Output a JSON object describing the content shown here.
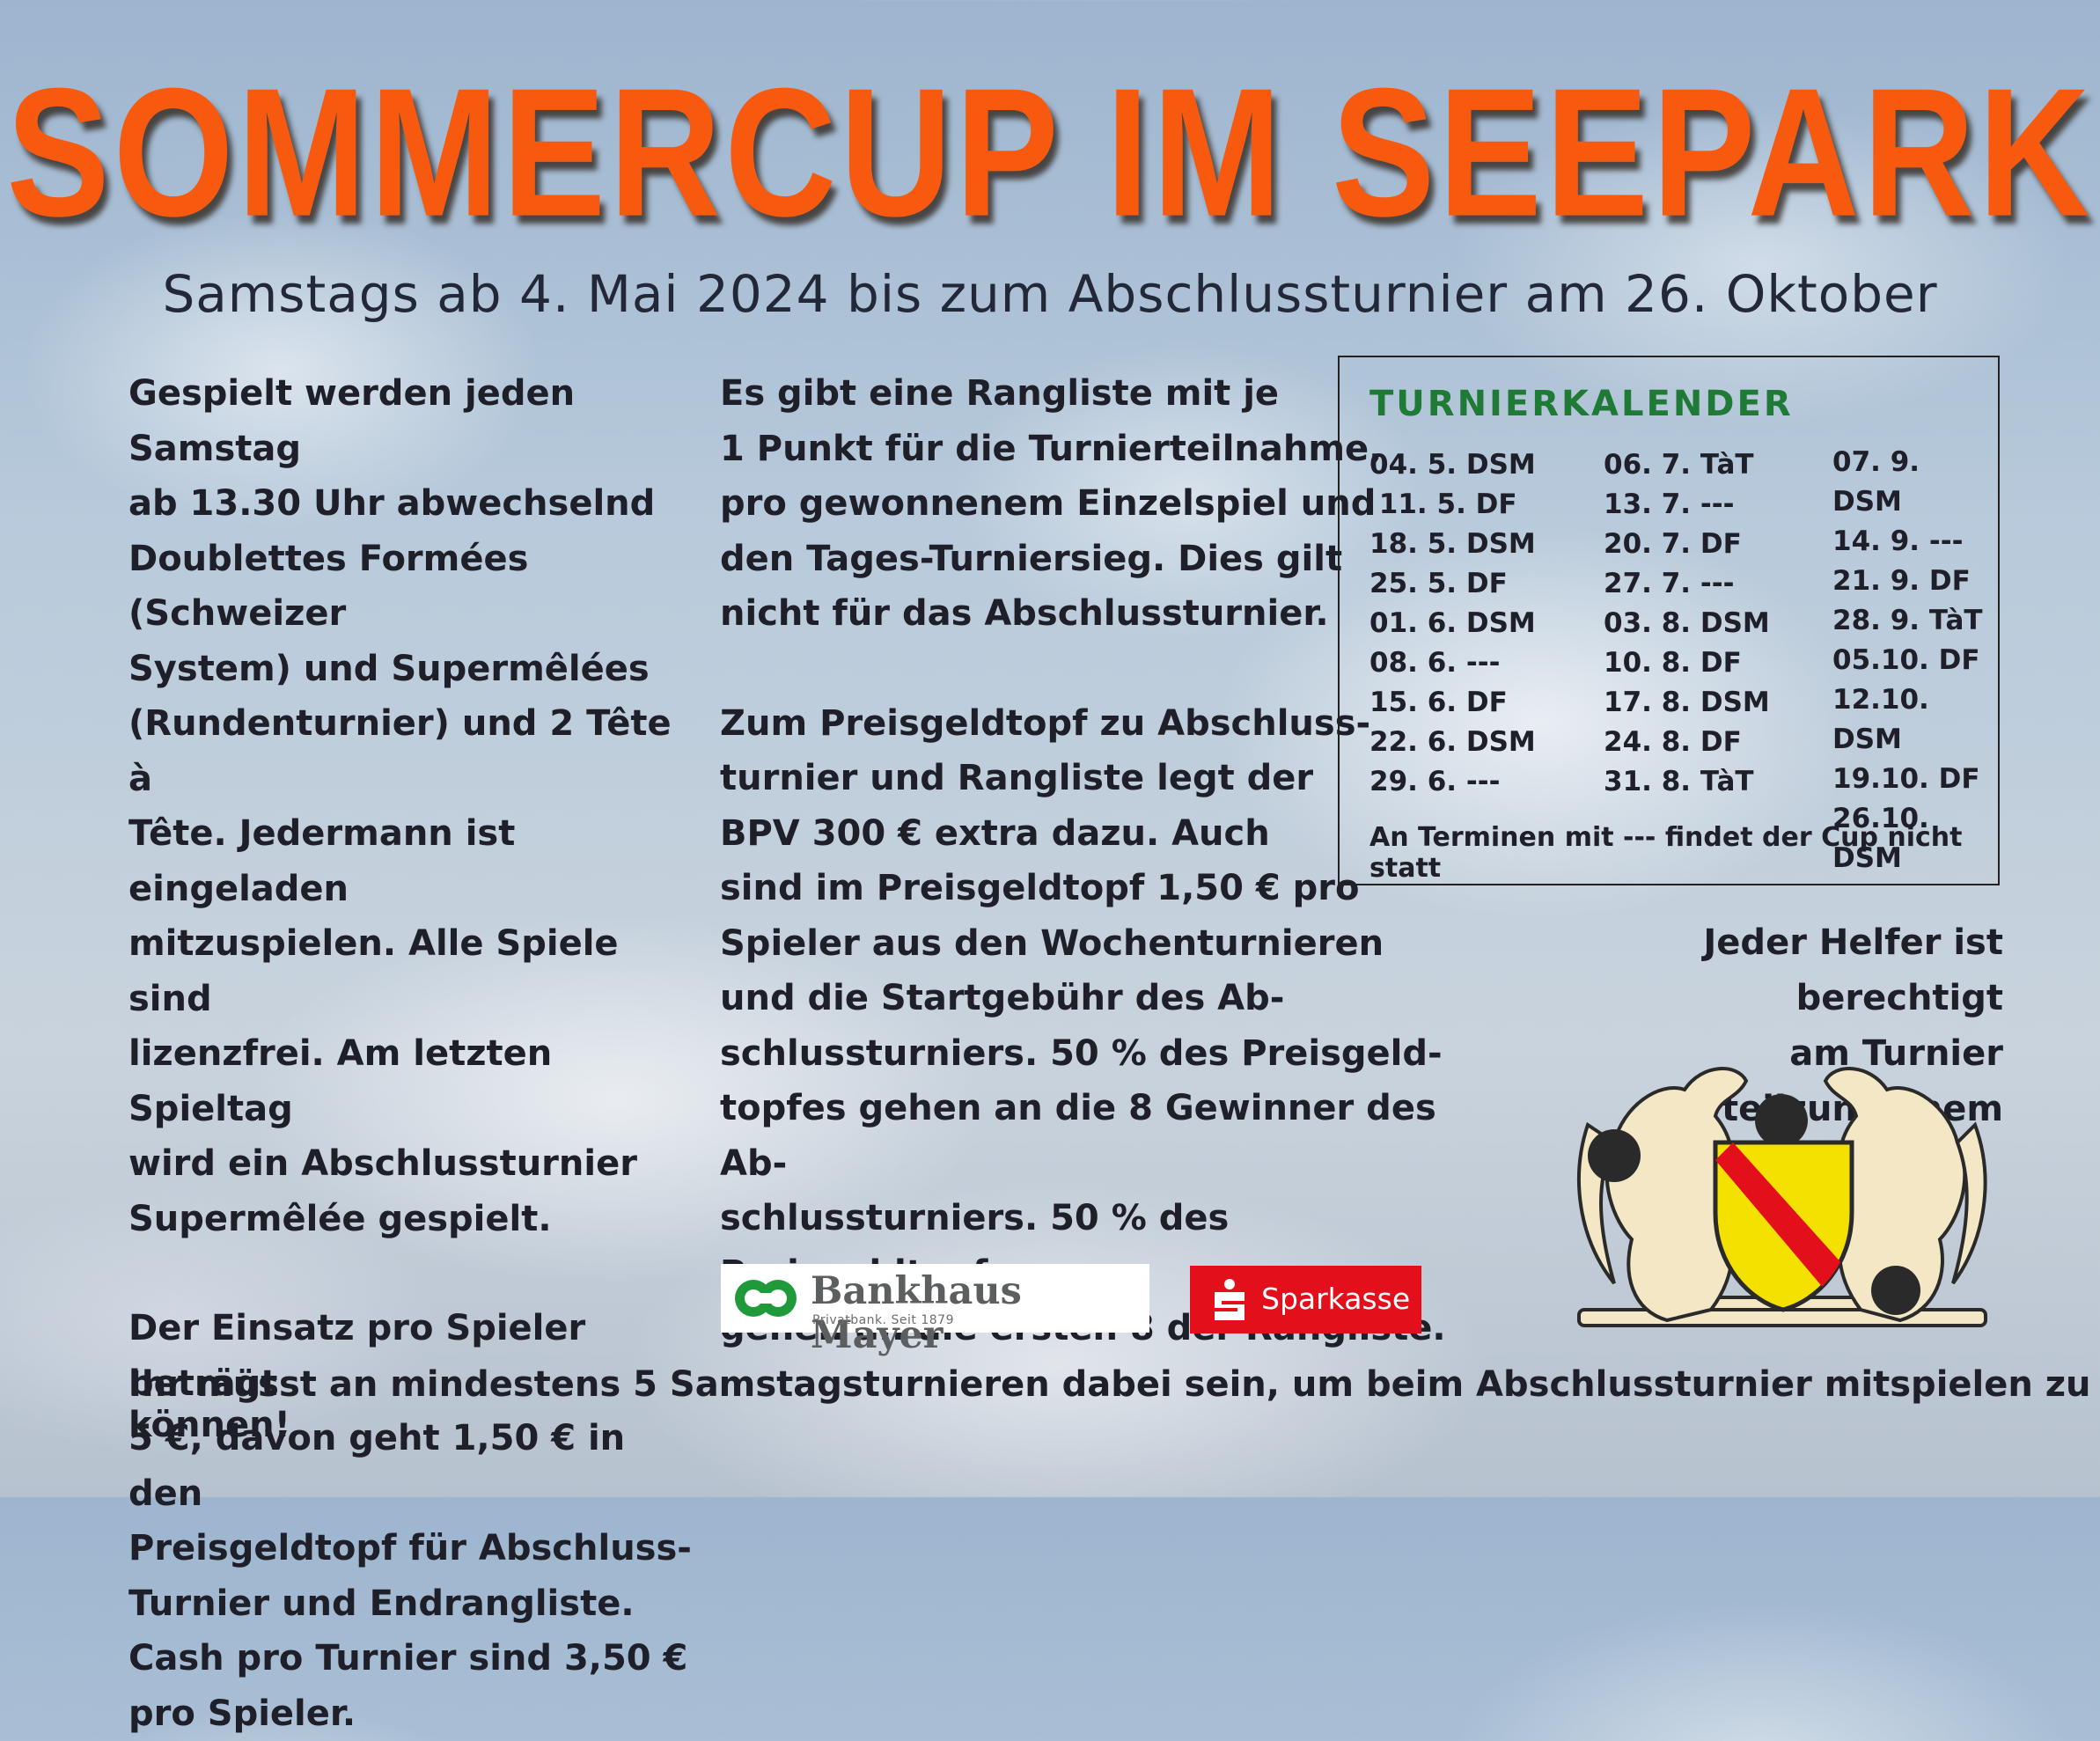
{
  "title": "SOMMERCUP IM SEEPARK",
  "subtitle": "Samstags ab 4. Mai 2024 bis zum Abschlussturnier am 26. Oktober",
  "column1": {
    "p1": [
      "Gespielt werden jeden Samstag",
      "ab 13.30 Uhr abwechselnd",
      "Doublettes Formées (Schweizer",
      "System) und Supermêlées",
      "(Rundenturnier) und 2 Tête à",
      "Tête. Jedermann ist eingeladen",
      "mitzuspielen. Alle Spiele sind",
      "lizenzfrei. Am letzten Spieltag",
      "wird ein Abschlussturnier",
      "Supermêlée gespielt."
    ],
    "p2": [
      "Der Einsatz pro Spieler beträgt",
      "5 €, davon geht 1,50 € in den",
      "Preisgeldtopf für Abschluss-",
      "Turnier und Endrangliste.",
      "Cash pro Turnier sind 3,50 €",
      "pro Spieler."
    ]
  },
  "column2": {
    "p1": [
      "Es gibt eine Rangliste mit je",
      "1 Punkt für die Turnierteilnahme,",
      "pro gewonnenem Einzelspiel und",
      "den Tages-Turniersieg. Dies gilt",
      "nicht für das Abschlussturnier."
    ],
    "p2": [
      "Zum Preisgeldtopf zu Abschluss-",
      "turnier und Rangliste legt der",
      "BPV 300 € extra dazu. Auch",
      "sind im Preisgeldtopf 1,50 € pro",
      "Spieler aus den Wochenturnieren",
      "und die Startgebühr des Ab-",
      "schlussturniers. 50 % des Preisgeld-",
      "topfes gehen an die 8 Gewinner des Ab-",
      "schlussturniers. 50 % des Preisgeldtopfes",
      "gehen an die ersten 8 der Rangliste."
    ]
  },
  "calendar": {
    "heading": "TURNIERKALENDER",
    "col1": [
      "04. 5. DSM",
      " 11. 5. DF",
      "18. 5. DSM",
      "25. 5. DF",
      "01. 6. DSM",
      "08. 6. ---",
      "15. 6. DF",
      "22. 6. DSM",
      "29. 6. ---"
    ],
    "col2": [
      "06. 7. TàT",
      "13. 7. ---",
      "20. 7. DF",
      "27. 7. ---",
      "03. 8. DSM",
      "10. 8. DF",
      "17. 8. DSM",
      "24. 8. DF",
      "31. 8. TàT"
    ],
    "col3": [
      "07. 9. DSM",
      "14. 9. ---",
      "21. 9. DF",
      "28. 9. TàT",
      "05.10. DF",
      "12.10. DSM",
      "19.10. DF",
      "26.10. DSM"
    ],
    "note": "An Terminen mit --- findet der Cup nicht statt"
  },
  "helper": [
    "Jeder Helfer ist berechtigt",
    "am Turnier teilzunehmem"
  ],
  "footer": "Ihr müsst an mindestens 5 Samstagsturnieren dabei sein, um beim Abschlussturnier mitspielen zu können!",
  "sponsors": {
    "bank_name": "Bankhaus Mayer",
    "bank_tagline": "Privatbank. Seit 1879",
    "sparkasse": "Sparkasse"
  },
  "colors": {
    "title": "#f75a0f",
    "calendar_heading": "#1e7a34",
    "bank_green": "#1f9a3a",
    "sparkasse_red": "#e3101c"
  }
}
